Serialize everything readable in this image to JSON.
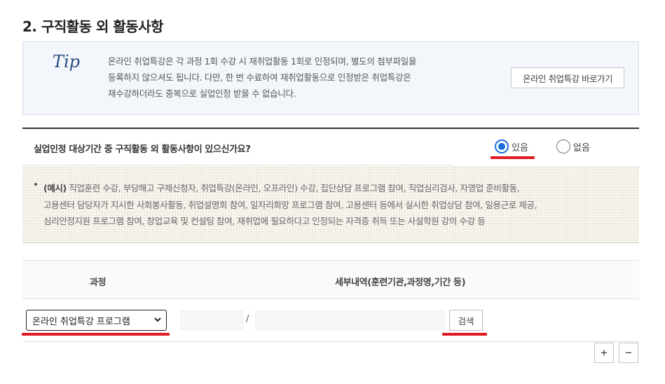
{
  "section": {
    "title": "2. 구직활동 외 활동사항"
  },
  "tip": {
    "label": "Tip",
    "lines": [
      "온라인 취업특강은 각 과정 1회 수강 시 재취업활동 1회로 인정되며, 별도의 첨부파일을",
      "등록하지 않으셔도 됩니다. 다만, 한 번 수료하여 재취업활동으로 인정받은 취업특강은",
      "재수강하더라도 중복으로 실업인정 받을 수 없습니다."
    ],
    "button_label": "온라인 취업특강 바로가기"
  },
  "question": {
    "text": "실업인정 대상기간 중 구직활동 외 활동사항이 있으신가요?",
    "options": [
      {
        "label": "있음",
        "selected": true
      },
      {
        "label": "없음",
        "selected": false
      }
    ]
  },
  "example": {
    "prefix": "(예시)",
    "lines": [
      "직업훈련 수강, 부당해고 구제신청자, 취업특강(온라인, 오프라인) 수강, 집단상담 프로그램 참여, 직업심리검사, 자영업 준비활동,",
      "고용센터 담당자가 지시한 사회봉사활동, 취업설명회 참여, 일자리희망 프로그램 참여, 고용센터 등에서 실시한 취업상담 참여, 일용근로 제공,",
      "심리안정지원 프로그램 참여, 창업교육 및 컨설팅 참여, 재취업에 필요하다고 인정되는 자격증 취득 또는 사설학원 강의 수강 등"
    ]
  },
  "table": {
    "headers": {
      "course": "과정",
      "detail": "세부내역(훈련기관,과정명,기간 등)"
    },
    "row": {
      "course_selected": "온라인 취업특강 프로그램",
      "separator": "/",
      "search_label": "검색"
    }
  },
  "controls": {
    "add_label": "+",
    "remove_label": "−"
  },
  "colors": {
    "highlight": "#e01b24",
    "radio_accent": "#1a6ee0",
    "tip_bg": "#f3f7fc"
  }
}
